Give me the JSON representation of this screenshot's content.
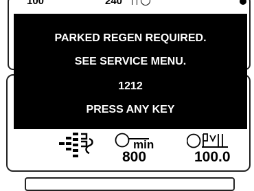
{
  "gauge": {
    "scale_min_label": "100",
    "scale_max_label": "240"
  },
  "status": {
    "regen_icon": "dpf-regen-icon",
    "rpm_icon": "engine-speed-icon",
    "rpm_unit": "min",
    "rpm_value": "800",
    "hours_icon": "engine-hours-icon",
    "hours_value": "100.0"
  },
  "popup": {
    "line1": "PARKED REGEN REQUIRED.",
    "line2": "SEE SERVICE MENU.",
    "code": "1212",
    "action": "PRESS ANY KEY"
  },
  "colors": {
    "popup_background": "#000000",
    "popup_text": "#ffffff",
    "screen_background": "#ffffff"
  }
}
